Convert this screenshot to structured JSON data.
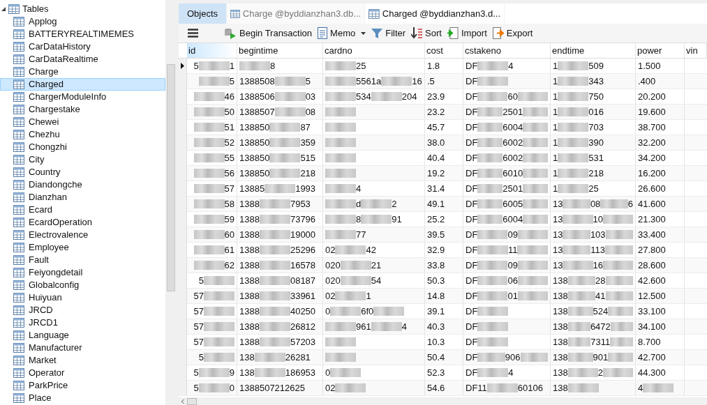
{
  "sidebar": {
    "group": {
      "label": "Tables",
      "expanded": true
    },
    "items": [
      {
        "label": "Applog",
        "selected": false
      },
      {
        "label": "BATTERYREALTIMEMES",
        "selected": false
      },
      {
        "label": "CarDataHistory",
        "selected": false
      },
      {
        "label": "CarDataRealtime",
        "selected": false
      },
      {
        "label": "Charge",
        "selected": false
      },
      {
        "label": "Charged",
        "selected": true
      },
      {
        "label": "ChargerModuleInfo",
        "selected": false
      },
      {
        "label": "Chargestake",
        "selected": false
      },
      {
        "label": "Chewei",
        "selected": false
      },
      {
        "label": "Chezhu",
        "selected": false
      },
      {
        "label": "Chongzhi",
        "selected": false
      },
      {
        "label": "City",
        "selected": false
      },
      {
        "label": "Country",
        "selected": false
      },
      {
        "label": "Diandongche",
        "selected": false
      },
      {
        "label": "Dianzhan",
        "selected": false
      },
      {
        "label": "Ecard",
        "selected": false
      },
      {
        "label": "EcardOperation",
        "selected": false
      },
      {
        "label": "Electrovalence",
        "selected": false
      },
      {
        "label": "Employee",
        "selected": false
      },
      {
        "label": "Fault",
        "selected": false
      },
      {
        "label": "Feiyongdetail",
        "selected": false
      },
      {
        "label": "Globalconfig",
        "selected": false
      },
      {
        "label": "Huiyuan",
        "selected": false
      },
      {
        "label": "JRCD",
        "selected": false
      },
      {
        "label": "JRCD1",
        "selected": false
      },
      {
        "label": "Language",
        "selected": false
      },
      {
        "label": "Manufacturer",
        "selected": false
      },
      {
        "label": "Market",
        "selected": false
      },
      {
        "label": "Operator",
        "selected": false
      },
      {
        "label": "ParkPrice",
        "selected": false
      },
      {
        "label": "Place",
        "selected": false
      }
    ]
  },
  "tabs": [
    {
      "kind": "objects",
      "label": "Objects",
      "selected": false
    },
    {
      "kind": "table",
      "label": "Charge @byddianzhan3.db...",
      "selected": false
    },
    {
      "kind": "table",
      "label": "Charged @byddianzhan3.d...",
      "selected": true
    }
  ],
  "toolbar": [
    {
      "kind": "menu"
    },
    {
      "kind": "transaction",
      "label": "Begin Transaction"
    },
    {
      "kind": "memo",
      "label": "Memo"
    },
    {
      "kind": "filter",
      "label": "Filter"
    },
    {
      "kind": "sort",
      "label": "Sort"
    },
    {
      "kind": "import",
      "label": "Import"
    },
    {
      "kind": "export",
      "label": "Export"
    }
  ],
  "table": {
    "columns": [
      {
        "label": "id",
        "selected": true
      },
      {
        "label": "begintime",
        "selected": false
      },
      {
        "label": "cardno",
        "selected": false
      },
      {
        "label": "cost",
        "selected": false
      },
      {
        "label": "cstakeno",
        "selected": false
      },
      {
        "label": "endtime",
        "selected": false
      },
      {
        "label": "power",
        "selected": false
      },
      {
        "label": "vin",
        "selected": false
      }
    ],
    "rows": [
      {
        "current": true,
        "cells": [
          [
            "5",
            null,
            "1"
          ],
          [
            null,
            "8"
          ],
          [
            null,
            "25"
          ],
          "1.8",
          [
            "DF",
            null,
            "4"
          ],
          [
            "1",
            null,
            "509"
          ],
          "1.500"
        ]
      },
      {
        "current": false,
        "cells": [
          [
            null,
            "5"
          ],
          [
            "1388508",
            null,
            "5"
          ],
          [
            null,
            "5561a",
            null,
            "16"
          ],
          ".5",
          [
            "DF",
            null
          ],
          [
            "1",
            null,
            "343"
          ],
          ".400"
        ]
      },
      {
        "current": false,
        "cells": [
          [
            null,
            "46"
          ],
          [
            "1388506",
            null,
            "03"
          ],
          [
            null,
            "534",
            null,
            "204"
          ],
          "23.9",
          [
            "DF",
            null,
            "60",
            null
          ],
          [
            "1",
            null,
            "750"
          ],
          "20.200"
        ]
      },
      {
        "current": false,
        "cells": [
          [
            null,
            "50"
          ],
          [
            "1388507",
            null,
            "08"
          ],
          [
            null
          ],
          "23.2",
          [
            "DF",
            null,
            "2501",
            null
          ],
          [
            "1",
            null,
            "016"
          ],
          "19.600"
        ]
      },
      {
        "current": false,
        "cells": [
          [
            null,
            "51"
          ],
          [
            "138850",
            null,
            "87"
          ],
          [
            null
          ],
          "45.7",
          [
            "DF",
            null,
            "6004",
            null
          ],
          [
            "1",
            null,
            "703"
          ],
          "38.700"
        ]
      },
      {
        "current": false,
        "cells": [
          [
            null,
            "52"
          ],
          [
            "138850",
            null,
            "359"
          ],
          [
            null
          ],
          "38.0",
          [
            "DF",
            null,
            "6002",
            null
          ],
          [
            "1",
            null,
            "390"
          ],
          "32.200"
        ]
      },
      {
        "current": false,
        "cells": [
          [
            null,
            "55"
          ],
          [
            "138850",
            null,
            "515"
          ],
          [
            null
          ],
          "40.4",
          [
            "DF",
            null,
            "6002",
            null
          ],
          [
            "1",
            null,
            "531"
          ],
          "34.200"
        ]
      },
      {
        "current": false,
        "cells": [
          [
            null,
            "56"
          ],
          [
            "138850",
            null,
            "218"
          ],
          [
            null
          ],
          "19.2",
          [
            "DF",
            null,
            "6010",
            null
          ],
          [
            "1",
            null,
            "218"
          ],
          "16.200"
        ]
      },
      {
        "current": false,
        "cells": [
          [
            null,
            "57"
          ],
          [
            "13885",
            null,
            "1993"
          ],
          [
            null,
            "4"
          ],
          "31.4",
          [
            "DF",
            null,
            "2501",
            null
          ],
          [
            "1",
            null,
            "25"
          ],
          "26.600"
        ]
      },
      {
        "current": false,
        "cells": [
          [
            null,
            "58"
          ],
          [
            "1388",
            null,
            "7953"
          ],
          [
            null,
            "d",
            null,
            "2"
          ],
          "49.1",
          [
            "DF",
            null,
            "6005",
            null
          ],
          [
            "13",
            null,
            "08",
            null,
            "6"
          ],
          "41.600"
        ]
      },
      {
        "current": false,
        "cells": [
          [
            null,
            "59"
          ],
          [
            "1388",
            null,
            "73796"
          ],
          [
            null,
            "8",
            null,
            "91"
          ],
          "25.2",
          [
            "DF",
            null,
            "6004",
            null
          ],
          [
            "13",
            null,
            "10",
            null
          ],
          "21.300"
        ]
      },
      {
        "current": false,
        "cells": [
          [
            null,
            "60"
          ],
          [
            "1388",
            null,
            "19000"
          ],
          [
            null,
            "77"
          ],
          "39.5",
          [
            "DF",
            null,
            "09",
            null
          ],
          [
            "13",
            null,
            "103",
            null
          ],
          "33.400"
        ]
      },
      {
        "current": false,
        "cells": [
          [
            null,
            "61"
          ],
          [
            "1388",
            null,
            "25296"
          ],
          [
            "02",
            null,
            "42"
          ],
          "32.9",
          [
            "DF",
            null,
            "11",
            null
          ],
          [
            "13",
            null,
            "113",
            null
          ],
          "27.800"
        ]
      },
      {
        "current": false,
        "cells": [
          [
            null,
            "62"
          ],
          [
            "1388",
            null,
            "16578"
          ],
          [
            "020",
            null,
            "21"
          ],
          "33.8",
          [
            "DF",
            null,
            "09",
            null
          ],
          [
            "13",
            null,
            "16",
            null
          ],
          "28.600"
        ]
      },
      {
        "current": false,
        "cells": [
          [
            "5",
            null
          ],
          [
            "1388",
            null,
            "08187"
          ],
          [
            "020",
            null,
            "54"
          ],
          "50.3",
          [
            "DF",
            null,
            "06",
            null
          ],
          [
            "138",
            null,
            "28",
            null
          ],
          "42.600"
        ]
      },
      {
        "current": false,
        "cells": [
          [
            "57",
            null
          ],
          [
            "1388",
            null,
            "33961"
          ],
          [
            "02",
            null,
            "1"
          ],
          "14.8",
          [
            "DF",
            null,
            "01",
            null
          ],
          [
            "138",
            null,
            "41",
            null
          ],
          "12.500"
        ]
      },
      {
        "current": false,
        "cells": [
          [
            "57",
            null
          ],
          [
            "1388",
            null,
            "40250"
          ],
          [
            "0",
            null,
            "6f0",
            null
          ],
          "39.1",
          [
            "DF",
            null
          ],
          [
            "138",
            null,
            "524",
            null
          ],
          "33.100"
        ]
      },
      {
        "current": false,
        "cells": [
          [
            "57",
            null
          ],
          [
            "1388",
            null,
            "26812"
          ],
          [
            null,
            "961",
            null,
            "4"
          ],
          "40.3",
          [
            "DF",
            null
          ],
          [
            "138",
            null,
            "6472",
            null
          ],
          "34.100"
        ]
      },
      {
        "current": false,
        "cells": [
          [
            "57",
            null
          ],
          [
            "1388",
            null,
            "57203"
          ],
          [
            null
          ],
          "10.3",
          [
            "DF",
            null
          ],
          [
            "138",
            null,
            "7311",
            null
          ],
          "8.700"
        ]
      },
      {
        "current": false,
        "cells": [
          [
            "5",
            null
          ],
          [
            "138",
            null,
            "26281"
          ],
          [
            null
          ],
          "50.4",
          [
            "DF",
            null,
            "906",
            null
          ],
          [
            "138",
            null,
            "901",
            null
          ],
          "42.700"
        ]
      },
      {
        "current": false,
        "cells": [
          [
            "5",
            null,
            "9"
          ],
          [
            "138",
            null,
            "186953"
          ],
          [
            "0",
            null
          ],
          "52.3",
          [
            "DF",
            null,
            "4"
          ],
          [
            "138",
            null,
            "2",
            null
          ],
          "44.300"
        ]
      },
      {
        "current": false,
        "cells": [
          [
            "5",
            null,
            "0"
          ],
          "1388507212625",
          [
            "02",
            null
          ],
          "54.6",
          [
            "DF11",
            null,
            "60106"
          ],
          [
            "138",
            null
          ],
          [
            "4",
            null
          ]
        ]
      }
    ]
  }
}
